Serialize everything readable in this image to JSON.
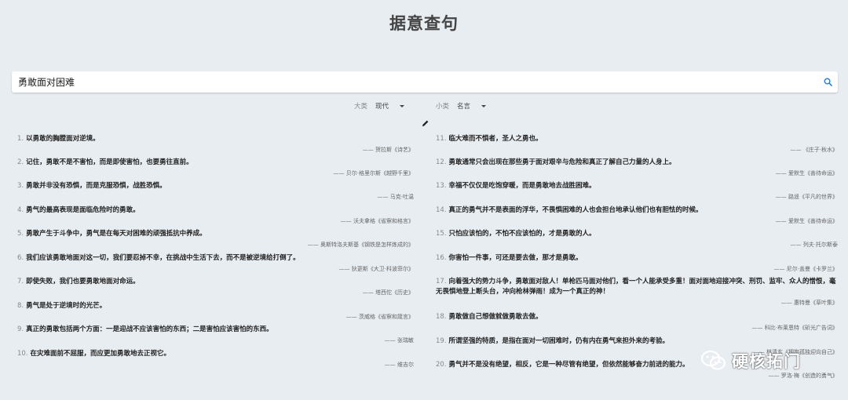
{
  "header": {
    "title": "据意查句"
  },
  "search": {
    "value": "勇敢面对困难"
  },
  "filters": {
    "category": {
      "label": "大类",
      "value": "现代"
    },
    "subcategory": {
      "label": "小类",
      "value": "名言"
    }
  },
  "results": [
    {
      "num": "1.",
      "text": "以勇敢的胸膛面对逆境。",
      "author": "—— 贺拉斯《诗艺》"
    },
    {
      "num": "2.",
      "text": "记住，勇敢不是不害怕，而是即使害怕，也要勇往直前。",
      "author": "—— 贝尔·格里尔斯《越野千里》"
    },
    {
      "num": "3.",
      "text": "勇敢并非没有恐惧，而是克服恐惧，战胜恐惧。",
      "author": "—— 马克·吐温"
    },
    {
      "num": "4.",
      "text": "勇气的最高表现是面临危险时的勇敢。",
      "author": "—— 沃夫拿格《省察和格言》"
    },
    {
      "num": "5.",
      "text": "勇敢产生于斗争中，勇气是在每天对困难的顽强抵抗中养成。",
      "author": "—— 奥斯特洛夫斯基《钢铁是怎样炼成的》"
    },
    {
      "num": "6.",
      "text": "我们应该勇敢地面对这一切，我们要忍掉不幸，在挑战中生活下去，而不是被逆境给打倒了。",
      "author": "—— 狄更斯《大卫·科波菲尔》"
    },
    {
      "num": "7.",
      "text": "即使失败，我们也要勇敢地面对命运。",
      "author": "—— 塔西佗《历史》"
    },
    {
      "num": "8.",
      "text": "勇气是处于逆境时的光芒。",
      "author": "—— 茨威格《省察和箴言》"
    },
    {
      "num": "9.",
      "text": "真正的勇敢包括两个方面：一是迎战不应该害怕的东西；二是害怕应该害怕的东西。",
      "author": "—— 张瑞敏"
    },
    {
      "num": "10.",
      "text": "在灾难面前不屈服，而应更加勇敢地去正视它。",
      "author": "—— 维吉尔"
    },
    {
      "num": "11.",
      "text": "临大难而不惧者，圣人之勇也。",
      "author": "—— 《庄子·秋水》"
    },
    {
      "num": "12.",
      "text": "勇敢通常只会出现在那些勇于面对艰辛与危险和真正了解自己力量的人身上。",
      "author": "—— 爱默生《善待命运》"
    },
    {
      "num": "13.",
      "text": "幸福不仅仅是吃饱穿暖，而是勇敢地去战胜困难。",
      "author": "—— 路遥《平凡的世界》"
    },
    {
      "num": "14.",
      "text": "真正的勇气并不是表面的浮华，不畏惧困难的人也会担台地承认他们也有胆怯的时候。",
      "author": "—— 爱默生《善待命运》"
    },
    {
      "num": "15.",
      "text": "只怕应该怕的，不怕不应该怕的，才是勇敢的人。",
      "author": "—— 列夫·托尔斯泰"
    },
    {
      "num": "16.",
      "text": "你害怕一件事，可还是要去做，那才是勇敢。",
      "author": "—— 尼尔·盖曼《卡罗兰》"
    },
    {
      "num": "17.",
      "text": "向着强大的势力斗争，勇敢面对敌人！单枪匹马面对他们，看一个人能承受多重！面对面地迎接冲突、刑罚、监牢、众人的憎恨，毫无畏惧地登上断头台，冲向枪林弹雨！成为一个真正的神！",
      "author": "—— 惠特曼《草叶集》"
    },
    {
      "num": "18.",
      "text": "勇敢做自己想做就做勇敢去做。",
      "author": "—— 科比·布莱恩特《斫光广告词》"
    },
    {
      "num": "19.",
      "text": "所谓坚强的特质，是指在面对一切困难时，仍有内在勇气来担外来的考验。",
      "author": "—— 林清玄《拥抱孤独迎向自己》"
    },
    {
      "num": "20.",
      "text": "勇气并不是没有绝望，相反，它是一种尽管有绝望，但依然能够奋力前进的能力。",
      "author": "—— 罗洛·梅《创造的勇气》"
    }
  ],
  "watermark": {
    "text": "硬核拓门"
  }
}
